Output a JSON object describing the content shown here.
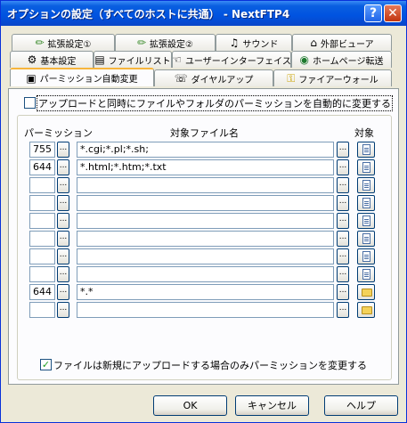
{
  "window": {
    "title": "オプションの設定（すべてのホストに共通） - NextFTP4",
    "help_glyph": "?",
    "close_glyph": "✕"
  },
  "tabs": {
    "row1": [
      {
        "label": "拡張設定①",
        "icon": "✏"
      },
      {
        "label": "拡張設定②",
        "icon": "✏"
      },
      {
        "label": "サウンド",
        "icon": "♫"
      },
      {
        "label": "外部ビューア",
        "icon": "⌂"
      }
    ],
    "row2": [
      {
        "label": "基本設定",
        "icon": "⚙"
      },
      {
        "label": "ファイルリスト",
        "icon": "▤"
      },
      {
        "label": "ユーザーインターフェイス",
        "icon": "☜"
      },
      {
        "label": "ホームページ転送",
        "icon": "◉"
      }
    ],
    "row3": [
      {
        "label": "パーミッション自動変更",
        "icon": "▣",
        "active": true
      },
      {
        "label": "ダイヤルアップ",
        "icon": "☏"
      },
      {
        "label": "ファイアーウォール",
        "icon": "⚿"
      }
    ]
  },
  "auto_change": {
    "label": "アップロードと同時にファイルやフォルダのパーミッションを自動的に変更する",
    "checked": false
  },
  "table": {
    "headers": {
      "permission": "パーミッション",
      "filename": "対象ファイル名",
      "target": "対象"
    },
    "browse_label": "...",
    "rows": [
      {
        "permission": "755",
        "filename": "*.cgi;*.pl;*.sh;",
        "target": "file"
      },
      {
        "permission": "644",
        "filename": "*.html;*.htm;*.txt",
        "target": "file"
      },
      {
        "permission": "",
        "filename": "",
        "target": "file"
      },
      {
        "permission": "",
        "filename": "",
        "target": "file"
      },
      {
        "permission": "",
        "filename": "",
        "target": "file"
      },
      {
        "permission": "",
        "filename": "",
        "target": "file"
      },
      {
        "permission": "",
        "filename": "",
        "target": "file"
      },
      {
        "permission": "",
        "filename": "",
        "target": "file"
      },
      {
        "permission": "644",
        "filename": "*.*",
        "target": "folder"
      },
      {
        "permission": "",
        "filename": "",
        "target": "folder"
      }
    ]
  },
  "new_only": {
    "label": "ファイルは新規にアップロードする場合のみパーミッションを変更する",
    "checked": true
  },
  "buttons": {
    "ok": "OK",
    "cancel": "キャンセル",
    "help": "ヘルプ"
  }
}
